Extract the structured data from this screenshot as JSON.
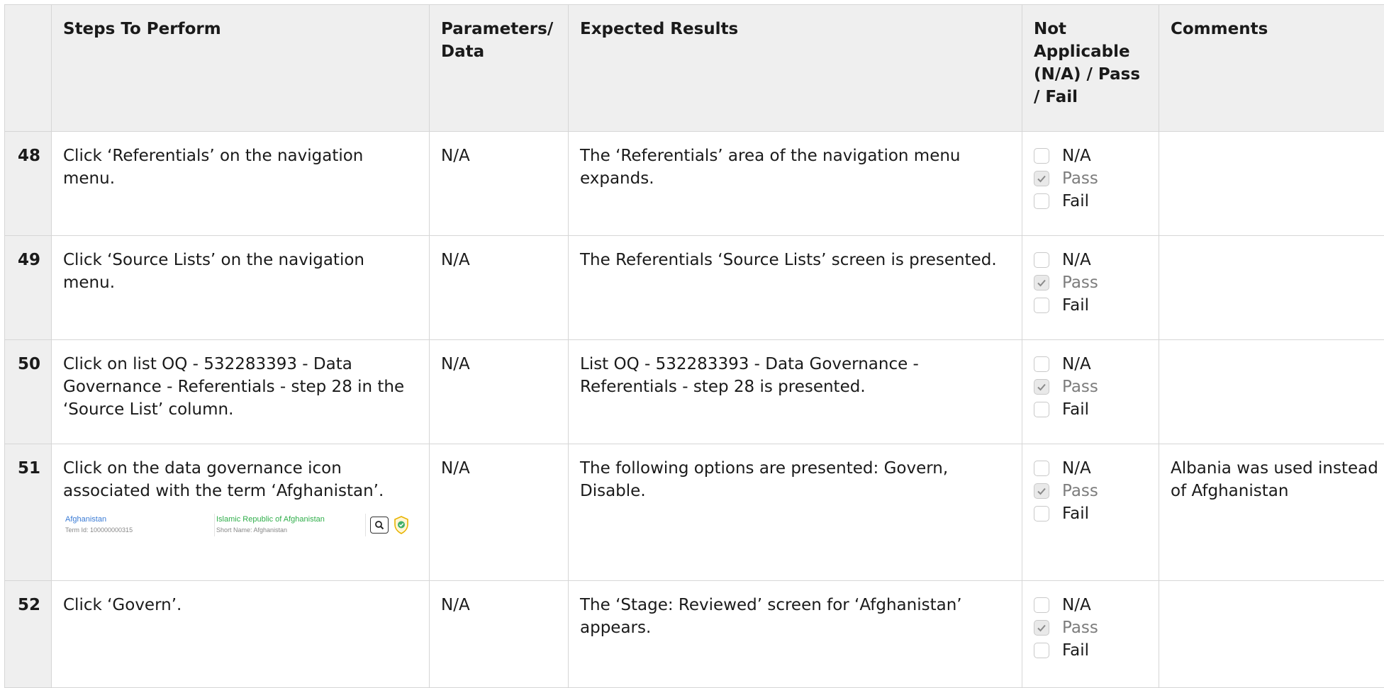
{
  "headers": {
    "steps": "Steps To Perform",
    "params": "Parameters/ Data",
    "expected": "Expected Results",
    "status": "Not Applicable (N/A) / Pass / Fail",
    "comments": "Comments"
  },
  "options": {
    "na": "N/A",
    "pass": "Pass",
    "fail": "Fail"
  },
  "rows": [
    {
      "num": "48",
      "step": "Click ‘Referentials’ on the navigation menu.",
      "params": "N/A",
      "expected": "The ‘Referentials’ area of the navigation menu expands.",
      "comment": "",
      "checked": "pass"
    },
    {
      "num": "49",
      "step": "Click ‘Source Lists’ on the navigation menu.",
      "params": "N/A",
      "expected": "The Referentials ‘Source Lists’ screen is presented.",
      "comment": "",
      "checked": "pass"
    },
    {
      "num": "50",
      "step": "Click on list OQ - 532283393 - Data Governance - Referentials - step 28 in the ‘Source List’ column.",
      "params": "N/A",
      "expected": "List OQ - 532283393 - Data Governance - Referentials - step 28 is presented.",
      "comment": "",
      "checked": "pass"
    },
    {
      "num": "51",
      "step": "Click on the data governance icon associated with the term ‘Afghanistan’.",
      "params": "N/A",
      "expected": "The following options are presented: Govern, Disable.",
      "comment": "Albania was used instead of Afghanistan",
      "checked": "pass",
      "screenshot": {
        "term": "Afghanistan",
        "term_id": "Term Id: 100000000315",
        "full_name": "Islamic Republic of Afghanistan",
        "short_name": "Short Name: Afghanistan"
      }
    },
    {
      "num": "52",
      "step": "Click ‘Govern’.",
      "params": "N/A",
      "expected": "The ‘Stage: Reviewed’ screen for ‘Afghanistan’ appears.",
      "comment": "",
      "checked": "pass"
    }
  ],
  "colors": {
    "header_bg": "#efefef",
    "border": "#d6d6d6",
    "term_link": "#3a7bd5",
    "full_name": "#2fae4a",
    "muted": "#7d7d7d"
  }
}
